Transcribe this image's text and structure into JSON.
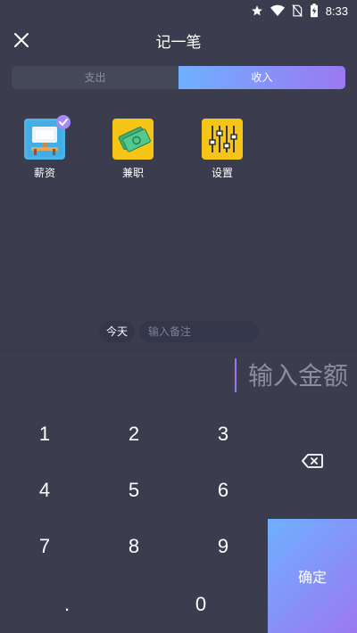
{
  "status_bar": {
    "time": "8:33",
    "icons": [
      "star-icon",
      "wifi-icon",
      "no-sim-icon",
      "battery-charging-icon"
    ]
  },
  "header": {
    "title": "记一笔",
    "close_icon": "close-icon"
  },
  "tabs": [
    {
      "label": "支出",
      "active": false
    },
    {
      "label": "收入",
      "active": true
    }
  ],
  "categories": [
    {
      "label": "薪资",
      "icon": "salary-desk-icon",
      "selected": true
    },
    {
      "label": "兼职",
      "icon": "money-icon",
      "selected": false
    },
    {
      "label": "设置",
      "icon": "sliders-icon",
      "selected": false
    }
  ],
  "memo": {
    "date_label": "今天",
    "placeholder": "输入备注",
    "value": ""
  },
  "amount": {
    "placeholder": "输入金额",
    "value": ""
  },
  "keypad": {
    "keys": [
      "1",
      "2",
      "3",
      "4",
      "5",
      "6",
      "7",
      "8",
      "9",
      ".",
      "0"
    ],
    "backspace_icon": "backspace-icon",
    "confirm_label": "确定"
  },
  "colors": {
    "background": "#3b3d4f",
    "accent_start": "#6fb0ff",
    "accent_end": "#9b78f2",
    "icon_tile": "#f5c518"
  }
}
